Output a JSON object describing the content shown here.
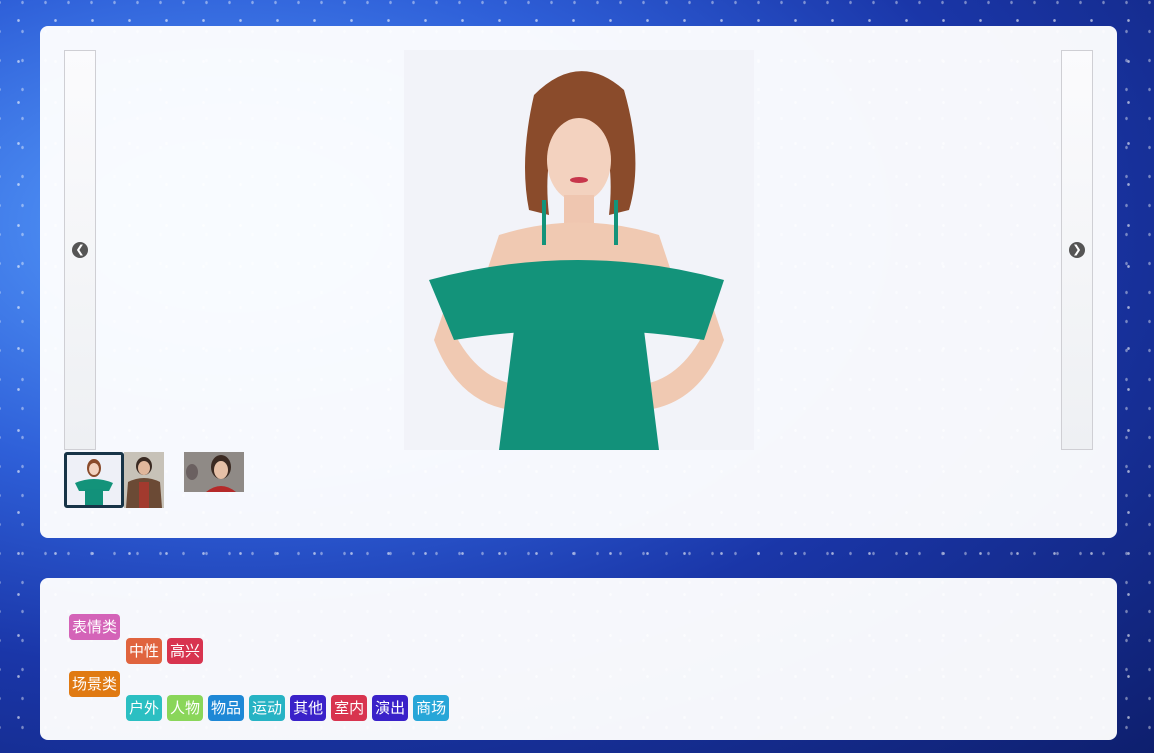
{
  "gallery": {
    "prev_icon": "chevron-left-circle-icon",
    "next_icon": "chevron-right-circle-icon",
    "main_photo_description_icon": "woman-green-dress-photo",
    "thumbnails": [
      {
        "name": "thumb-woman-green-dress",
        "active": true
      },
      {
        "name": "thumb-woman-brown-coat",
        "active": false
      },
      {
        "name": "thumb-girl-red-top",
        "active": false
      }
    ]
  },
  "tags": {
    "groups": [
      {
        "label": "表情类",
        "color": "#d463b8",
        "items": [
          {
            "label": "中性",
            "color": "#e0643e"
          },
          {
            "label": "高兴",
            "color": "#d8344f"
          }
        ]
      },
      {
        "label": "场景类",
        "color": "#e07a12",
        "items": [
          {
            "label": "户外",
            "color": "#2bbfc2"
          },
          {
            "label": "人物",
            "color": "#8ad65a"
          },
          {
            "label": "物品",
            "color": "#1e88d6"
          },
          {
            "label": "运动",
            "color": "#27b3c4"
          },
          {
            "label": "其他",
            "color": "#3a22c9"
          },
          {
            "label": "室内",
            "color": "#d8344f"
          },
          {
            "label": "演出",
            "color": "#3a22c9"
          },
          {
            "label": "商场",
            "color": "#27a6d8"
          }
        ]
      }
    ]
  }
}
